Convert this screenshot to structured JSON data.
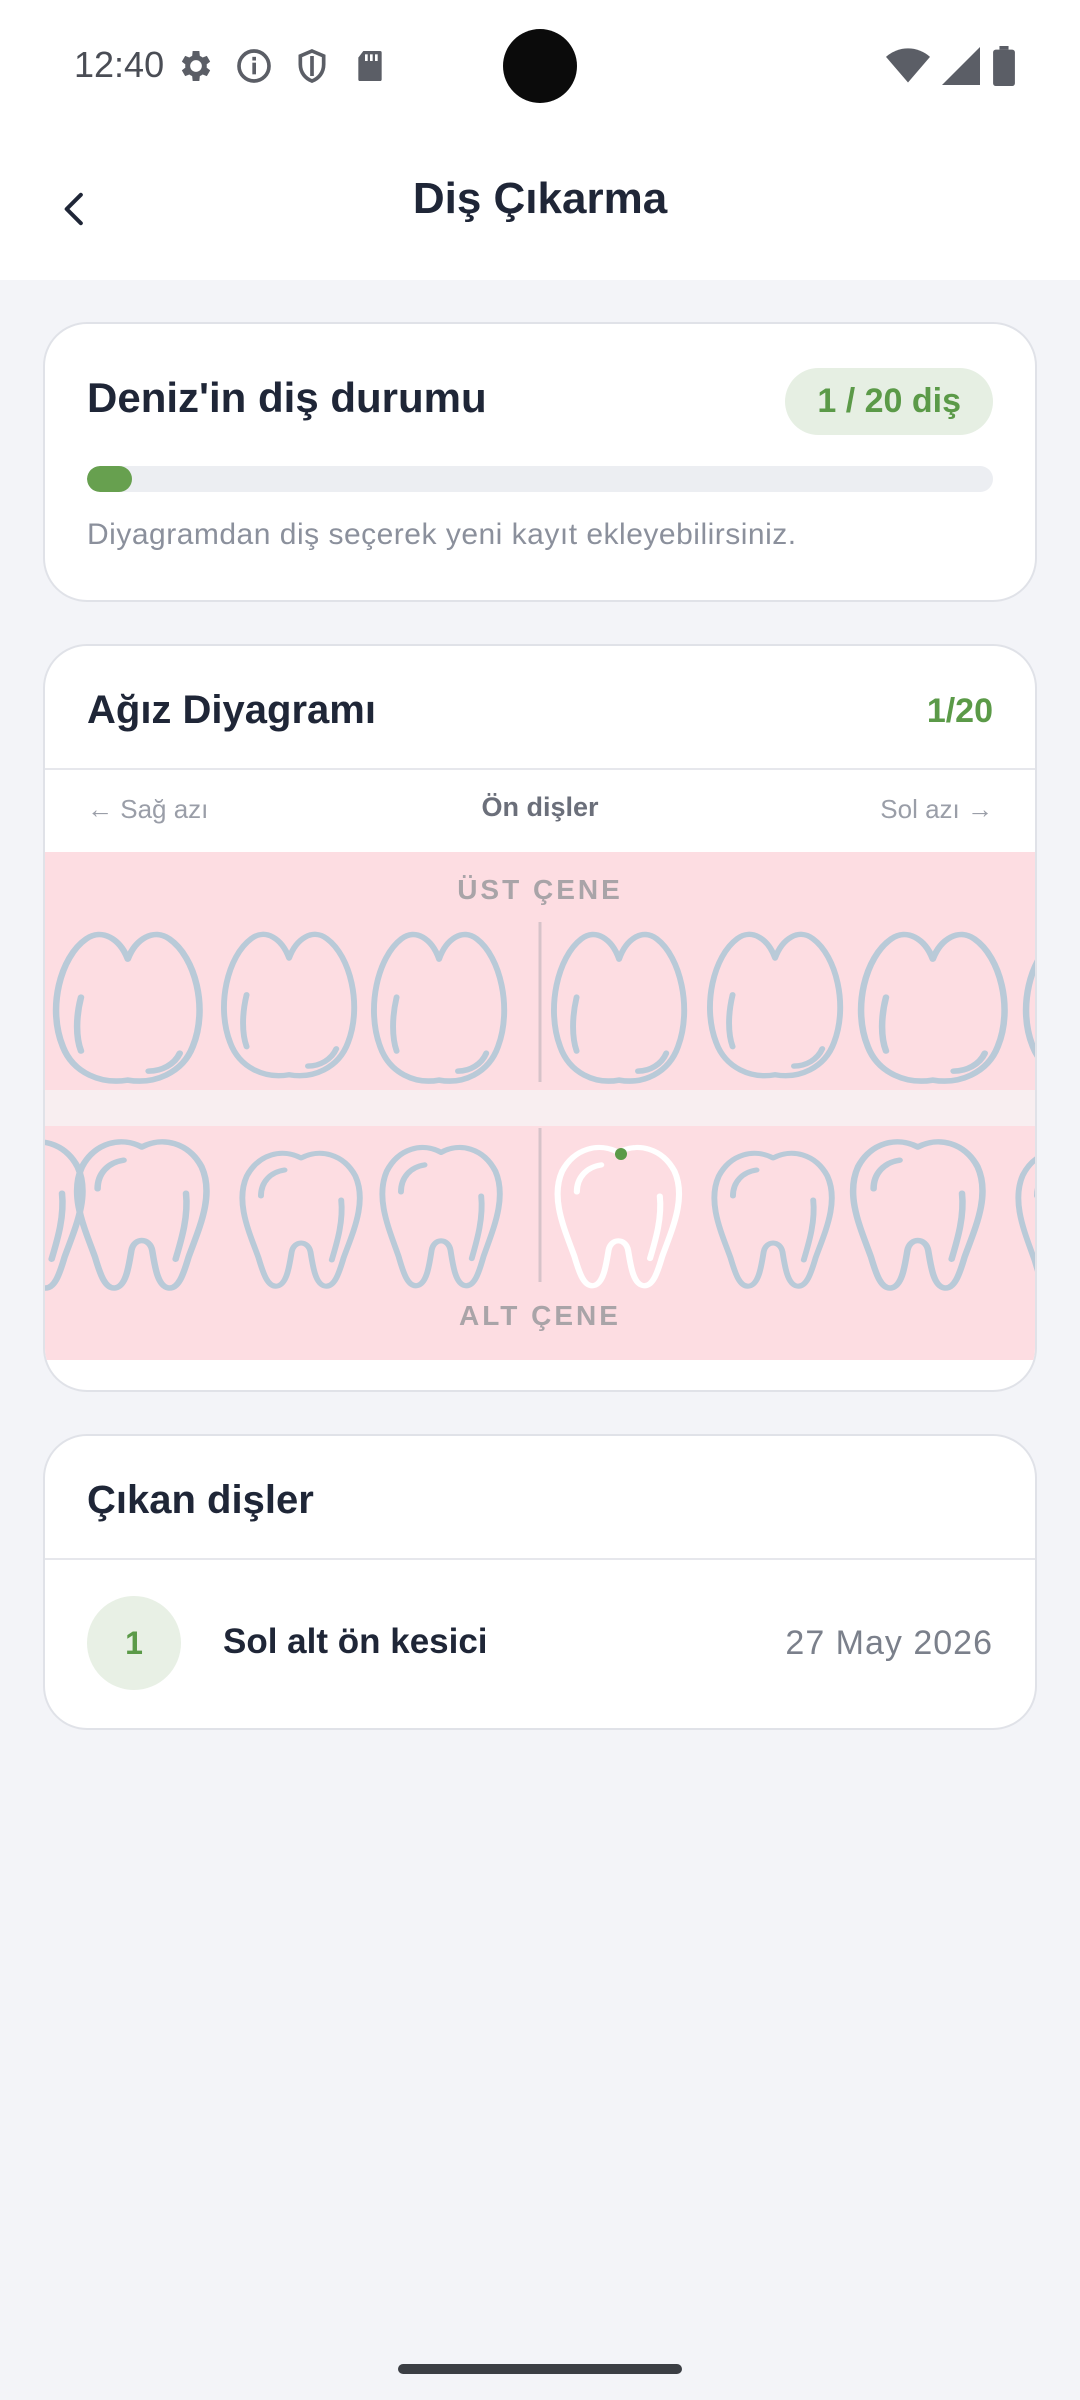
{
  "status_bar": {
    "time": "12:40",
    "left_icons": [
      "settings-icon",
      "info-icon",
      "shield-icon",
      "sd-card-icon"
    ],
    "right_icons": [
      "wifi-icon",
      "signal-icon",
      "battery-icon"
    ]
  },
  "app_bar": {
    "title": "Diş Çıkarma",
    "back_icon": "chevron-left-icon"
  },
  "status_card": {
    "title": "Deniz'in diş durumu",
    "badge": "1 / 20 diş",
    "progress": 0.05,
    "hint": "Diyagramdan diş seçerek yeni kayıt ekleyebilirsiniz."
  },
  "diagram": {
    "title": "Ağız Diyagramı",
    "count": "1/20",
    "nav_left": "← Sağ azı",
    "nav_center": "Ön dişler",
    "nav_right": "Sol azı →",
    "upper_label": "ÜST ÇENE",
    "lower_label": "ALT ÇENE",
    "selected_tooth": "lower-5"
  },
  "extracted": {
    "title": "Çıkan dişler",
    "items": [
      {
        "index": "1",
        "name": "Sol alt ön kesici",
        "date": "27 May 2026"
      }
    ]
  },
  "colors": {
    "accent_green": "#67a04f",
    "mouth_pink": "#fddde2",
    "tooth_outline": "#b9cad8"
  }
}
